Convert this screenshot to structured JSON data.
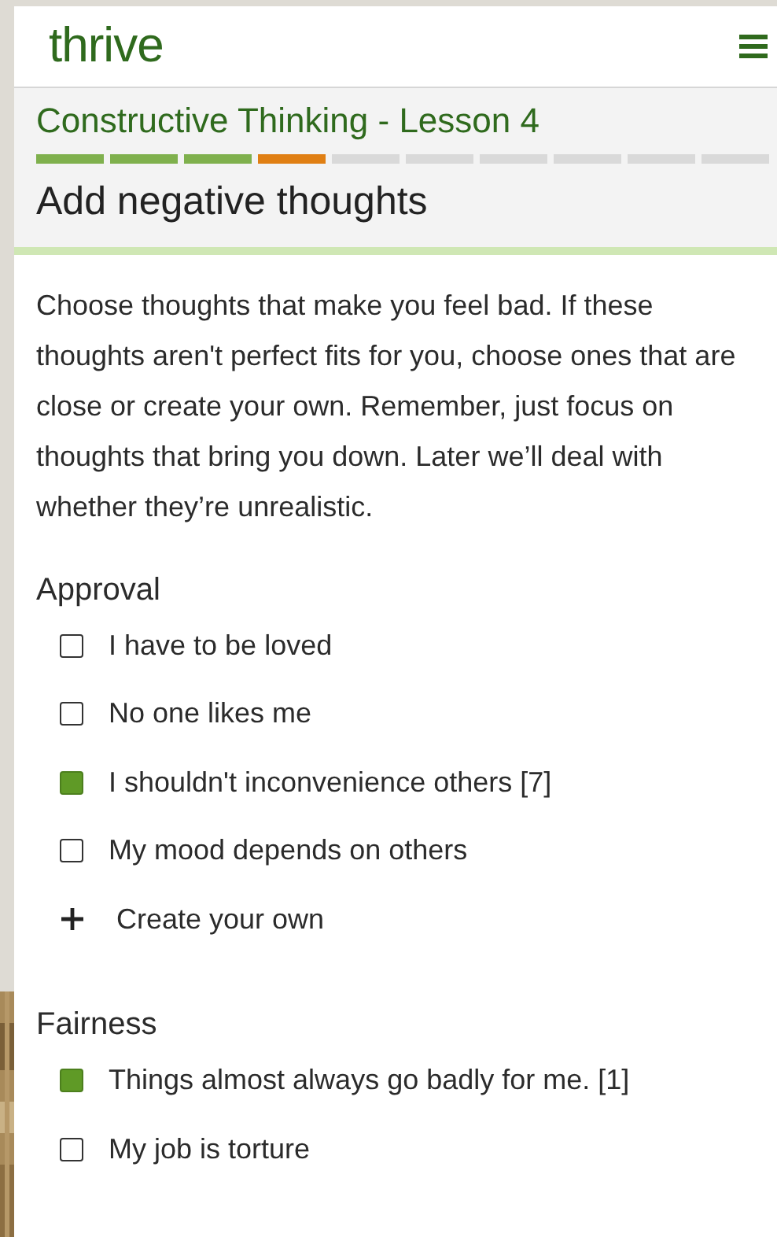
{
  "header": {
    "logo": "thrive"
  },
  "lesson": {
    "course_title": "Constructive Thinking - Lesson 4",
    "progress": [
      {
        "kind": "done"
      },
      {
        "kind": "done"
      },
      {
        "kind": "done"
      },
      {
        "kind": "current"
      },
      {
        "kind": "todo"
      },
      {
        "kind": "todo"
      },
      {
        "kind": "todo"
      },
      {
        "kind": "todo"
      },
      {
        "kind": "todo"
      },
      {
        "kind": "todo"
      }
    ],
    "heading": "Add negative thoughts"
  },
  "intro": "Choose thoughts that make you feel bad. If these thoughts aren't perfect fits for you, choose ones that are close or create your own. Remember, just focus on thoughts that bring you down. Later we’ll deal with whether they’re unrealistic.",
  "groups": [
    {
      "title": "Approval",
      "items": [
        {
          "kind": "checkbox",
          "label": "I have to be loved",
          "checked": false
        },
        {
          "kind": "checkbox",
          "label": "No one likes me",
          "checked": false
        },
        {
          "kind": "checkbox",
          "label": "I shouldn't inconvenience others [7]",
          "checked": true
        },
        {
          "kind": "checkbox",
          "label": "My mood depends on others",
          "checked": false
        },
        {
          "kind": "create",
          "label": "Create your own"
        }
      ]
    },
    {
      "title": "Fairness",
      "items": [
        {
          "kind": "checkbox",
          "label": "Things almost always go badly for me. [1]",
          "checked": true
        },
        {
          "kind": "checkbox",
          "label": "My job is torture",
          "checked": false
        }
      ]
    }
  ]
}
